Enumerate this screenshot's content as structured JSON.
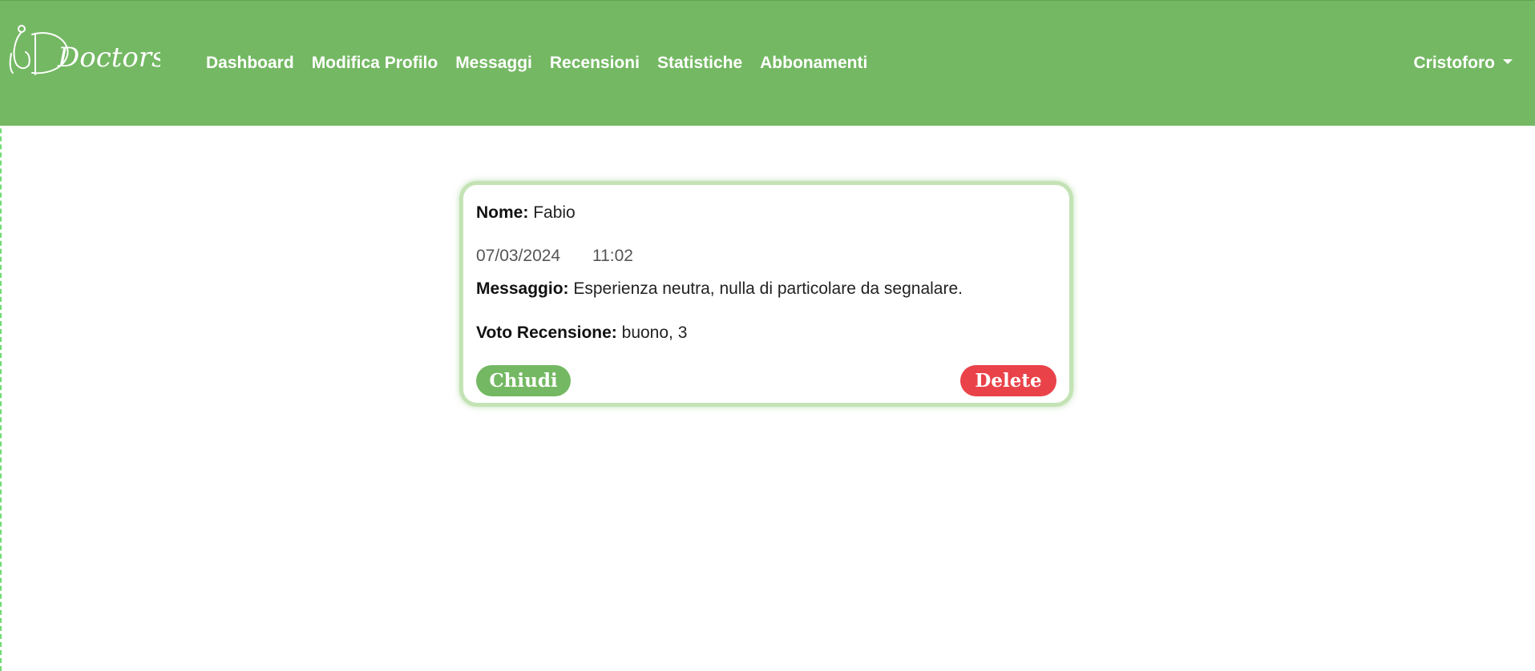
{
  "navbar": {
    "logo_text": "Doctors",
    "links": [
      "Dashboard",
      "Modifica Profilo",
      "Messaggi",
      "Recensioni",
      "Statistiche",
      "Abbonamenti"
    ],
    "user_name": "Cristoforo"
  },
  "review": {
    "name_label": "Nome:",
    "name_value": "Fabio",
    "date": "07/03/2024",
    "time": "11:02",
    "message_label": "Messaggio:",
    "message_value": "Esperienza neutra, nulla di particolare da segnalare.",
    "rating_label": "Voto Recensione:",
    "rating_value": "buono, 3",
    "close_label": "Chiudi",
    "delete_label": "Delete"
  },
  "colors": {
    "navbar_bg": "#74b863",
    "card_border": "#c4e3b5",
    "close_button": "#74b863",
    "delete_button": "#ea4249"
  }
}
